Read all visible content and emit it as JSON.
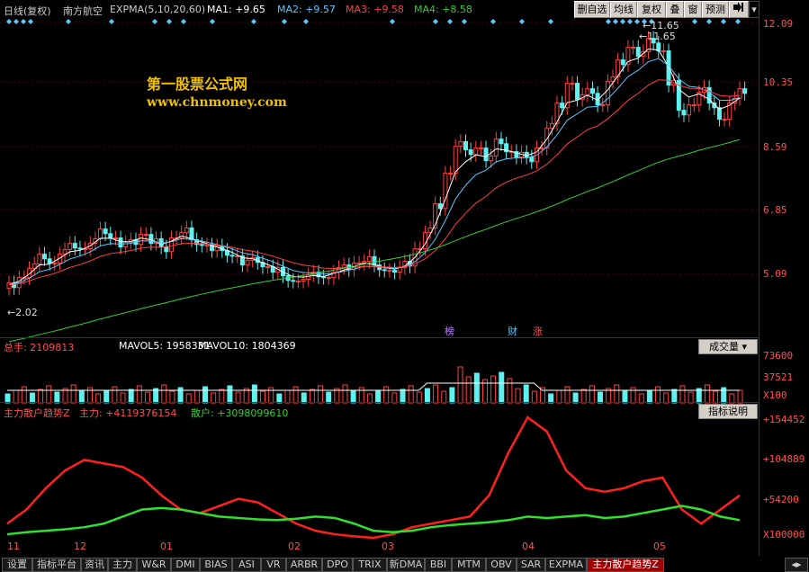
{
  "header": {
    "period": "日线(复权)",
    "stock": "南方航空",
    "indicator": "EXPMA(5,10,20,60)",
    "ma1": "MA1: +9.65",
    "ma2": "MA2: +9.57",
    "ma3": "MA3: +9.58",
    "ma4": "MA4: +8.58",
    "ma_colors": {
      "ma1": "#ffffff",
      "ma2": "#5ac8ff",
      "ma3": "#ff4040",
      "ma4": "#30d030"
    },
    "buttons": [
      "删自选",
      "均线",
      "复权",
      "叠",
      "窗",
      "预测"
    ],
    "nav_icon": "arrow-right-icon"
  },
  "watermark": {
    "title": "第一股票公式网",
    "url": "www.chnmoney.com"
  },
  "price_axis": [
    "12.09",
    "10.35",
    "8.59",
    "6.85",
    "5.09"
  ],
  "annotations": {
    "high": "11.65",
    "low": "2.02",
    "events": [
      "榜",
      "财",
      "涨"
    ]
  },
  "volume_panel": {
    "title": "总手: 2109813",
    "mavol5": "MAVOL5: 1958331",
    "mavol10": "MAVOL10: 1804369",
    "selector": "成交量",
    "axis": [
      "73600",
      "37521",
      "X100"
    ]
  },
  "indicator_panel": {
    "name": "主力散户趋势Z",
    "main_force": "主力: +4119376154",
    "retail": "散户: +3098099610",
    "help": "指标说明",
    "axis": [
      "+154452",
      "+104889",
      "+54200",
      "X100000"
    ]
  },
  "x_dates": [
    "11",
    "12",
    "01",
    "02",
    "03",
    "04",
    "05"
  ],
  "tabs": [
    "设置",
    "指标平台",
    "资讯",
    "主力",
    "W&R",
    "DMI",
    "BIAS",
    "ASI",
    "VR",
    "ARBR",
    "DPO",
    "TRIX",
    "新DMA",
    "BBI",
    "MTM",
    "OBV",
    "SAR",
    "EXPMA",
    "主力散户趋势Z"
  ],
  "active_tab": "主力散户趋势Z",
  "chart_data": {
    "type": "line",
    "price_closes": [
      4.8,
      5.0,
      5.3,
      5.6,
      5.4,
      5.7,
      5.9,
      5.8,
      6.0,
      6.3,
      6.1,
      5.9,
      6.0,
      6.2,
      6.0,
      5.8,
      6.1,
      6.3,
      6.0,
      5.9,
      5.8,
      5.7,
      5.6,
      5.4,
      5.5,
      5.3,
      5.2,
      5.0,
      4.9,
      5.0,
      5.1,
      5.0,
      5.2,
      5.3,
      5.4,
      5.5,
      5.3,
      5.2,
      5.2,
      5.4,
      5.8,
      6.3,
      7.0,
      7.9,
      8.7,
      8.5,
      8.6,
      8.3,
      8.8,
      8.5,
      8.4,
      8.3,
      8.6,
      9.2,
      9.8,
      10.4,
      10.0,
      10.2,
      9.8,
      10.5,
      11.0,
      11.4,
      11.2,
      11.6,
      11.3,
      10.4,
      9.6,
      9.8,
      10.2,
      9.8,
      9.4,
      9.9,
      10.2
    ],
    "main_force": [
      20,
      40,
      70,
      95,
      110,
      105,
      100,
      85,
      60,
      40,
      35,
      45,
      55,
      50,
      35,
      20,
      10,
      5,
      2,
      0,
      5,
      15,
      20,
      25,
      30,
      60,
      120,
      170,
      150,
      95,
      70,
      65,
      70,
      80,
      85,
      40,
      20,
      40,
      60
    ],
    "retail": [
      5,
      8,
      10,
      12,
      15,
      20,
      30,
      40,
      42,
      40,
      35,
      30,
      28,
      26,
      25,
      27,
      30,
      28,
      20,
      10,
      8,
      10,
      15,
      18,
      20,
      22,
      25,
      30,
      28,
      30,
      32,
      28,
      30,
      35,
      40,
      45,
      40,
      30,
      25
    ],
    "volume_bars": 90
  }
}
